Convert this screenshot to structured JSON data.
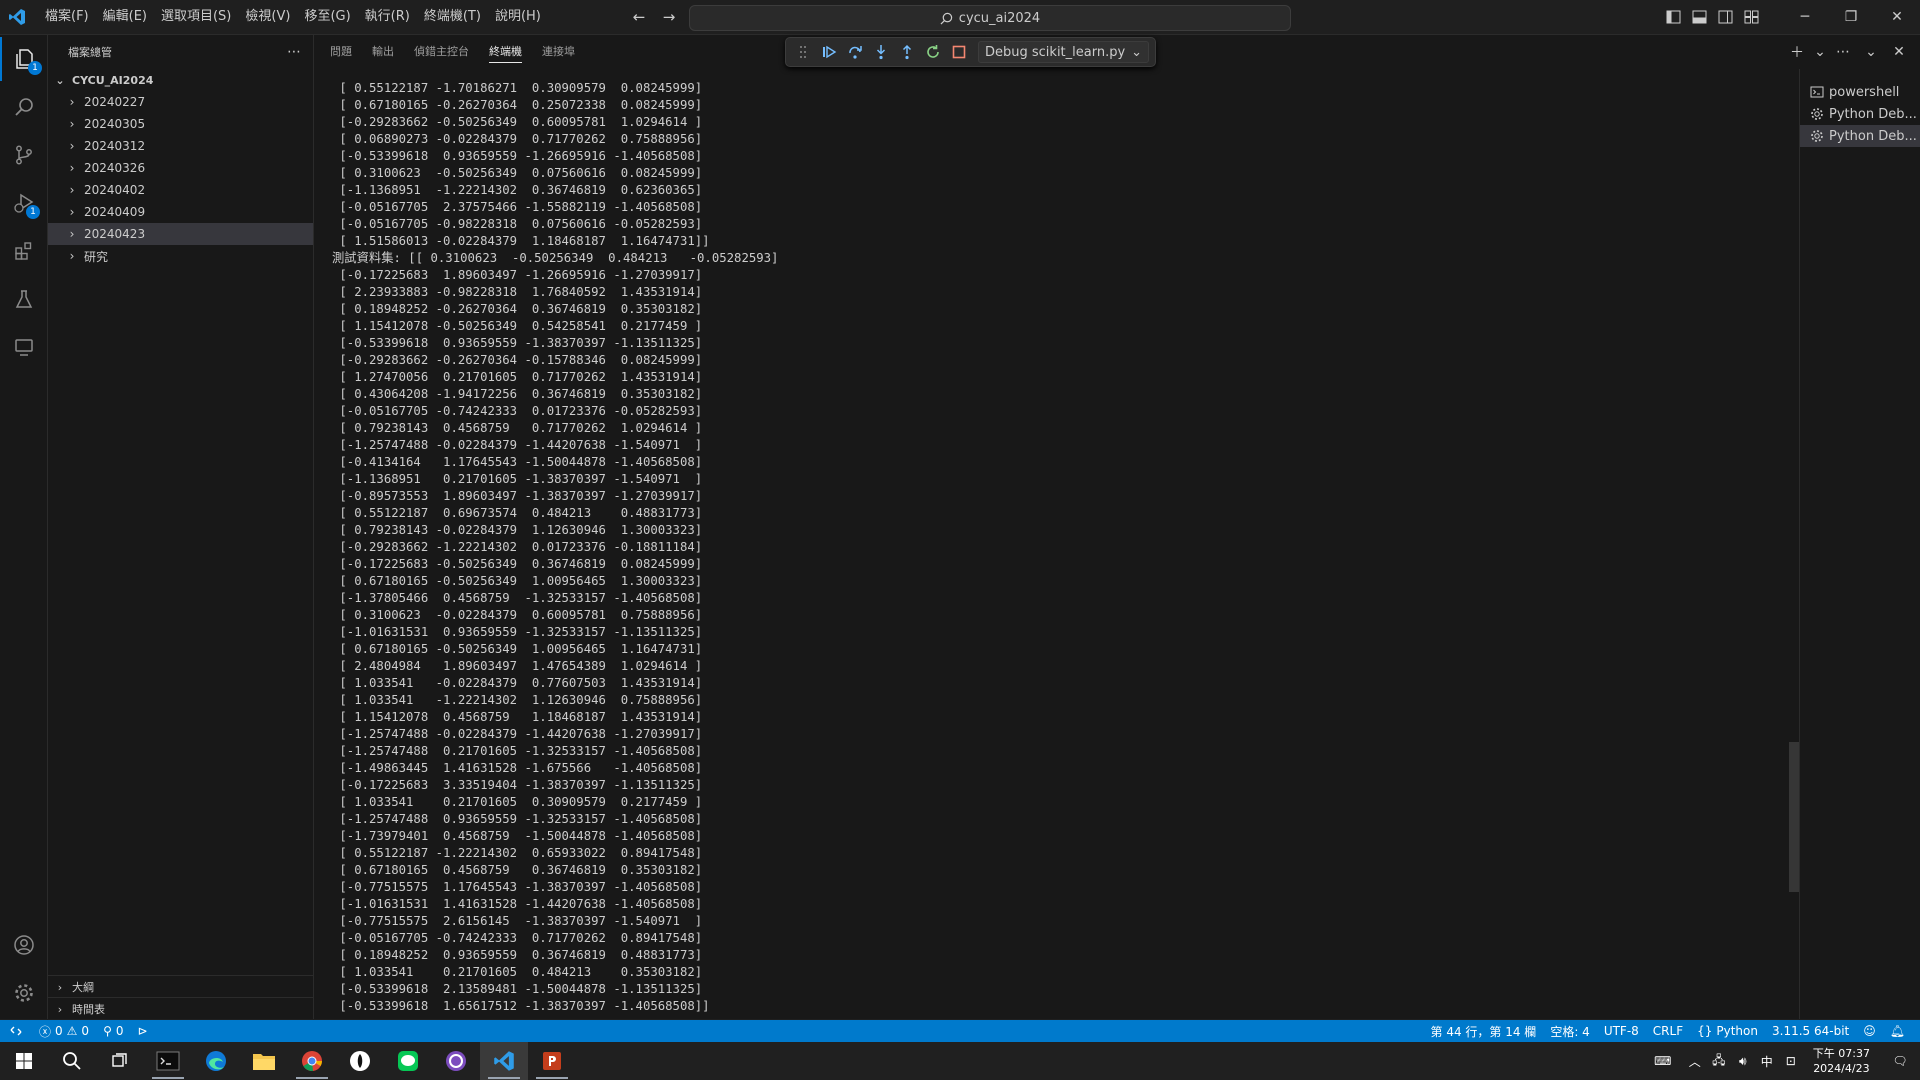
{
  "menu": [
    "檔案(F)",
    "編輯(E)",
    "選取項目(S)",
    "檢視(V)",
    "移至(G)",
    "執行(R)",
    "終端機(T)",
    "說明(H)"
  ],
  "search": {
    "text": "cycu_ai2024"
  },
  "sidebar": {
    "title": "檔案總管",
    "root": "CYCU_AI2024",
    "items": [
      {
        "label": "20240227"
      },
      {
        "label": "20240305"
      },
      {
        "label": "20240312"
      },
      {
        "label": "20240326"
      },
      {
        "label": "20240402"
      },
      {
        "label": "20240409"
      },
      {
        "label": "20240423"
      },
      {
        "label": "研究"
      }
    ],
    "outline": "大綱",
    "timeline": "時間表"
  },
  "activity": {
    "explorer_badge": "1",
    "debug_badge": "1"
  },
  "panel": {
    "tabs": [
      "問題",
      "輸出",
      "偵錯主控台",
      "終端機",
      "連接埠"
    ],
    "active_tab": "終端機",
    "debug_config": "Debug scikit_learn.py"
  },
  "terminal_lines": [
    " [ 0.55122187 -1.70186271  0.30909579  0.08245999]",
    " [ 0.67180165 -0.26270364  0.25072338  0.08245999]",
    " [-0.29283662 -0.50256349  0.60095781  1.0294614 ]",
    " [ 0.06890273 -0.02284379  0.71770262  0.75888956]",
    " [-0.53399618  0.93659559 -1.26695916 -1.40568508]",
    " [ 0.3100623  -0.50256349  0.07560616  0.08245999]",
    " [-1.1368951  -1.22214302  0.36746819  0.62360365]",
    " [-0.05167705  2.37575466 -1.55882119 -1.40568508]",
    " [-0.05167705 -0.98228318  0.07560616 -0.05282593]",
    " [ 1.51586013 -0.02284379  1.18468187  1.16474731]]",
    "測試資料集: [[ 0.3100623  -0.50256349  0.484213   -0.05282593]",
    " [-0.17225683  1.89603497 -1.26695916 -1.27039917]",
    " [ 2.23933883 -0.98228318  1.76840592  1.43531914]",
    " [ 0.18948252 -0.26270364  0.36746819  0.35303182]",
    " [ 1.15412078 -0.50256349  0.54258541  0.2177459 ]",
    " [-0.53399618  0.93659559 -1.38370397 -1.13511325]",
    " [-0.29283662 -0.26270364 -0.15788346  0.08245999]",
    " [ 1.27470056  0.21701605  0.71770262  1.43531914]",
    " [ 0.43064208 -1.94172256  0.36746819  0.35303182]",
    " [-0.05167705 -0.74242333  0.01723376 -0.05282593]",
    " [ 0.79238143  0.4568759   0.71770262  1.0294614 ]",
    " [-1.25747488 -0.02284379 -1.44207638 -1.540971  ]",
    " [-0.4134164   1.17645543 -1.50044878 -1.40568508]",
    " [-1.1368951   0.21701605 -1.38370397 -1.540971  ]",
    " [-0.89573553  1.89603497 -1.38370397 -1.27039917]",
    " [ 0.55122187  0.69673574  0.484213    0.48831773]",
    " [ 0.79238143 -0.02284379  1.12630946  1.30003323]",
    " [-0.29283662 -1.22214302  0.01723376 -0.18811184]",
    " [-0.17225683 -0.50256349  0.36746819  0.08245999]",
    " [ 0.67180165 -0.50256349  1.00956465  1.30003323]",
    " [-1.37805466  0.4568759  -1.32533157 -1.40568508]",
    " [ 0.3100623  -0.02284379  0.60095781  0.75888956]",
    " [-1.01631531  0.93659559 -1.32533157 -1.13511325]",
    " [ 0.67180165 -0.50256349  1.00956465  1.16474731]",
    " [ 2.4804984   1.89603497  1.47654389  1.0294614 ]",
    " [ 1.033541   -0.02284379  0.77607503  1.43531914]",
    " [ 1.033541   -1.22214302  1.12630946  0.75888956]",
    " [ 1.15412078  0.4568759   1.18468187  1.43531914]",
    " [-1.25747488 -0.02284379 -1.44207638 -1.27039917]",
    " [-1.25747488  0.21701605 -1.32533157 -1.40568508]",
    " [-1.49863445  1.41631528 -1.675566   -1.40568508]",
    " [-0.17225683  3.33519404 -1.38370397 -1.13511325]",
    " [ 1.033541    0.21701605  0.30909579  0.2177459 ]",
    " [-1.25747488  0.93659559 -1.32533157 -1.40568508]",
    " [-1.73979401  0.4568759  -1.50044878 -1.40568508]",
    " [ 0.55122187 -1.22214302  0.65933022  0.89417548]",
    " [ 0.67180165  0.4568759   0.36746819  0.35303182]",
    " [-0.77515575  1.17645543 -1.38370397 -1.40568508]",
    " [-1.01631531  1.41631528 -1.44207638 -1.40568508]",
    " [-0.77515575  2.6156145  -1.38370397 -1.540971  ]",
    " [-0.05167705 -0.74242333  0.71770262  0.89417548]",
    " [ 0.18948252  0.93659559  0.36746819  0.48831773]",
    " [ 1.033541    0.21701605  0.484213    0.35303182]",
    " [-0.53399618  2.13589481 -1.50044878 -1.13511325]",
    " [-0.53399618  1.65617512 -1.38370397 -1.40568508]]"
  ],
  "terminal_list": [
    {
      "label": "powershell"
    },
    {
      "label": "Python Deb..."
    },
    {
      "label": "Python Deb..."
    }
  ],
  "status": {
    "errors": "0",
    "warnings": "0",
    "ports": "0",
    "cursor": "第 44 行，第 14 欄",
    "spaces": "空格: 4",
    "encoding": "UTF-8",
    "eol": "CRLF",
    "language": "Python",
    "interpreter": "3.11.5 64-bit"
  },
  "taskbar": {
    "time": "下午 07:37",
    "date": "2024/4/23",
    "ime": "中"
  },
  "colors": {
    "accent": "#007acc",
    "badge": "#0078d4",
    "selection": "#37373d"
  }
}
